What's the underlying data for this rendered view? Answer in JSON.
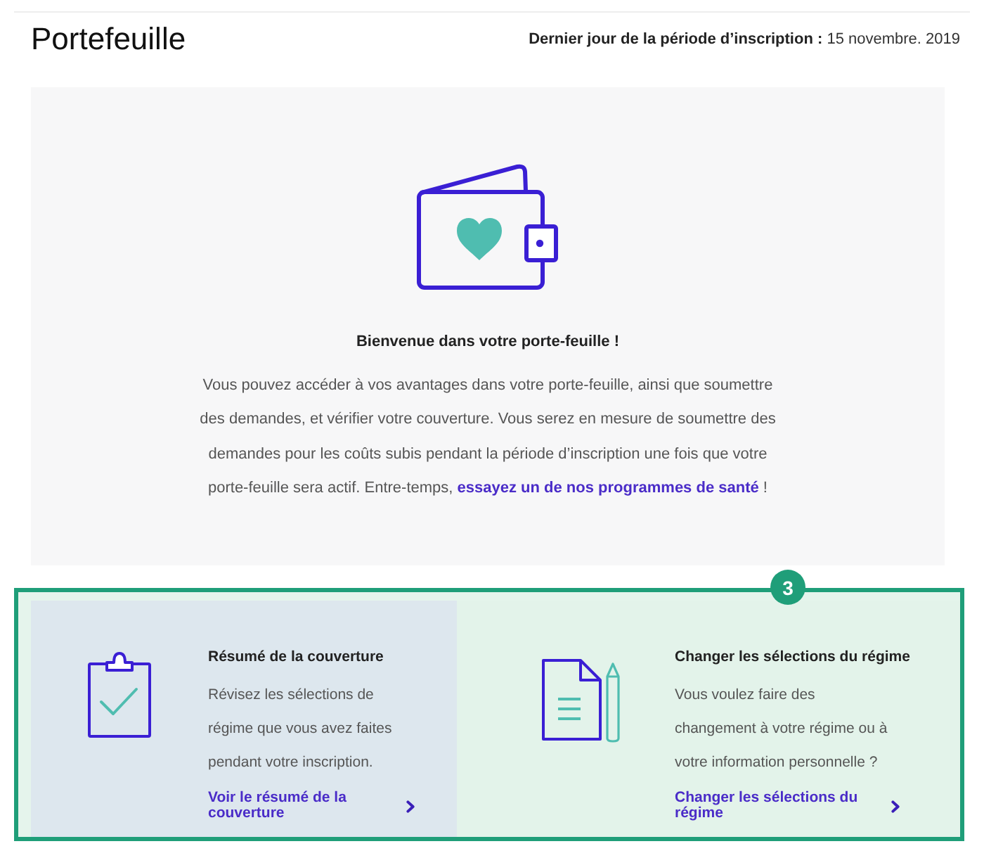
{
  "page": {
    "title": "Portefeuille",
    "deadline": "**Dernier jour de la période d’inscription :** 15 novembre. 2019"
  },
  "welcome": {
    "heading": "Bienvenue dans votre porte-feuille !",
    "text": "Vous pouvez accéder à vos avantages dans votre porte-feuille, ainsi que soumettre des demandes, et vérifier votre couverture. Vous serez en mesure de soumettre des demandes pour les coûts subis pendant la période d’inscription une fois que votre porte-feuille sera actif. Entre-temps,",
    "link": "essayez un de nos programmes de santé",
    "text_after": "!"
  },
  "callout": {
    "badge": "3",
    "cards": [
      {
        "kind": "coverage",
        "highlighted": true,
        "title": "Résumé de la couverture",
        "description": "Révisez les sélections de régime que vous avez faites pendant votre inscription.",
        "link": "Voir le résumé de la couverture"
      },
      {
        "kind": "change",
        "highlighted": false,
        "title": "Changer les sélections du régime",
        "description": "Vous voulez faire des changement à votre régime ou à votre information personnelle ?",
        "link": "Changer les sélections du régime"
      }
    ]
  }
}
